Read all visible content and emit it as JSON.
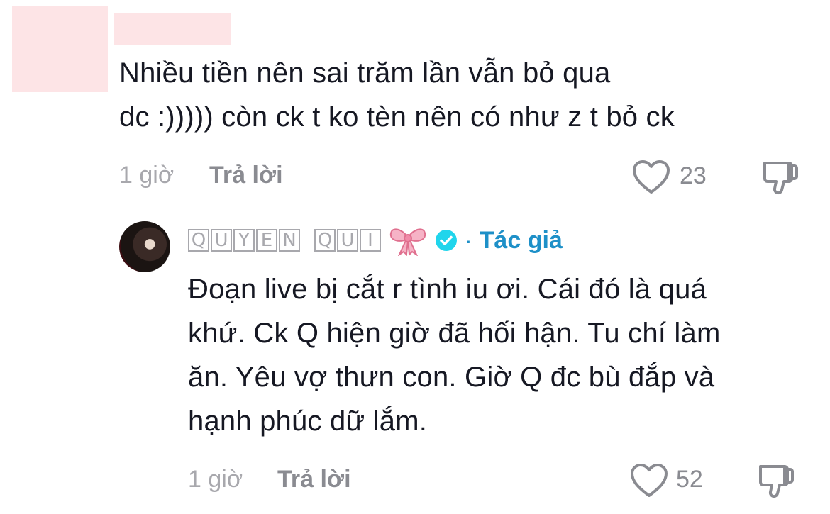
{
  "comment": {
    "text_line1": "Nhiều tiền nên sai trăm lần vẫn bỏ qua",
    "text_line2": "dc :))))) còn ck t ko tèn nên có như z t bỏ ck",
    "time": "1 giờ",
    "reply_label": "Trả lời",
    "like_count": "23"
  },
  "reply": {
    "author_name_chars": [
      "Q",
      "U",
      "Y",
      "E",
      "N",
      " ",
      "Q",
      "U",
      "I"
    ],
    "author_separator": "·",
    "author_label": "Tác giả",
    "text_line1": "Đoạn live bị cắt r tình iu ơi. Cái đó là quá",
    "text_line2": "khứ. Ck Q hiện giờ đã hối hận. Tu chí làm",
    "text_line3": "ăn. Yêu vợ thưn con. Giờ Q đc bù đắp và",
    "text_line4": "hạnh phúc dữ lắm.",
    "time": "1 giờ",
    "reply_label": "Trả lời",
    "like_count": "52"
  },
  "icons": {
    "like": "heart-outline-icon",
    "dislike": "thumbs-down-outline-icon",
    "verified": "verified-badge-icon",
    "decoration": "pink-bow-icon"
  },
  "colors": {
    "text": "#161823",
    "muted": "#a8a8ad",
    "author_accent": "#1e90c8",
    "verified": "#20d5ec",
    "redaction": "#fde4e6",
    "bow": "#f08aa8"
  }
}
